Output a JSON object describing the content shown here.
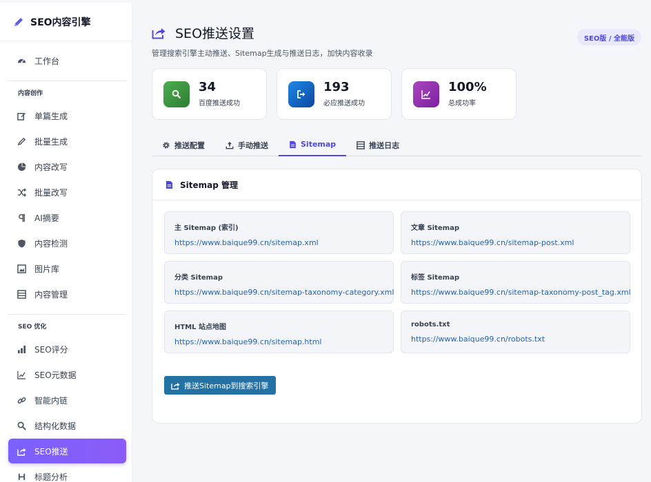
{
  "sidebar": {
    "brand_title": "SEO内容引擎",
    "items": [
      {
        "label": "工作台",
        "icon": "dashboard-icon"
      }
    ],
    "sections": [
      {
        "title": "内容创作",
        "items": [
          {
            "label": "单篇生成",
            "icon": "edit-square-icon"
          },
          {
            "label": "批量生成",
            "icon": "pencil-icon"
          },
          {
            "label": "内容改写",
            "icon": "pie-icon"
          },
          {
            "label": "批量改写",
            "icon": "shuffle-icon"
          },
          {
            "label": "AI摘要",
            "icon": "paragraph-icon"
          },
          {
            "label": "内容检测",
            "icon": "shield-icon"
          },
          {
            "label": "图片库",
            "icon": "image-icon"
          },
          {
            "label": "内容管理",
            "icon": "list-icon"
          }
        ]
      },
      {
        "title": "SEO 优化",
        "items": [
          {
            "label": "SEO评分",
            "icon": "bar-chart-icon"
          },
          {
            "label": "SEO元数据",
            "icon": "line-chart-icon"
          },
          {
            "label": "智能内链",
            "icon": "link-icon"
          },
          {
            "label": "结构化数据",
            "icon": "search-icon"
          },
          {
            "label": "SEO推送",
            "icon": "share-icon",
            "active": true
          },
          {
            "label": "标题分析",
            "icon": "heading-icon"
          }
        ]
      }
    ]
  },
  "header": {
    "title": "SEO推送设置",
    "subtitle": "管理搜索引擎主动推送、Sitemap生成与推送日志，加快内容收录",
    "badge": "SEO版 / 全能版"
  },
  "stats": [
    {
      "value": "34",
      "label": "百度推送成功",
      "color": "#43a047"
    },
    {
      "value": "193",
      "label": "必应推送成功",
      "color": "#1565c0"
    },
    {
      "value": "100%",
      "label": "总成功率",
      "color": "#8e24aa"
    }
  ],
  "tabs": [
    {
      "label": "推送配置",
      "icon": "gear-icon"
    },
    {
      "label": "手动推送",
      "icon": "upload-icon"
    },
    {
      "label": "Sitemap",
      "icon": "document-icon",
      "active": true
    },
    {
      "label": "推送日志",
      "icon": "log-list-icon"
    }
  ],
  "panel": {
    "title": "Sitemap 管理",
    "sitemaps": [
      {
        "name": "主 Sitemap (索引)",
        "url": "https://www.baique99.cn/sitemap.xml"
      },
      {
        "name": "文章 Sitemap",
        "url": "https://www.baique99.cn/sitemap-post.xml"
      },
      {
        "name": "分类 Sitemap",
        "url": "https://www.baique99.cn/sitemap-taxonomy-category.xml"
      },
      {
        "name": "标签 Sitemap",
        "url": "https://www.baique99.cn/sitemap-taxonomy-post_tag.xml"
      },
      {
        "name": "HTML 站点地图",
        "url": "https://www.baique99.cn/sitemap.html"
      },
      {
        "name": "robots.txt",
        "url": "https://www.baique99.cn/robots.txt"
      }
    ],
    "push_button": "推送Sitemap到搜索引擎"
  },
  "colors": {
    "accent": "#4f46e5",
    "active_nav": "#7b61ff",
    "button": "#2471a3",
    "link": "#2563a8"
  }
}
